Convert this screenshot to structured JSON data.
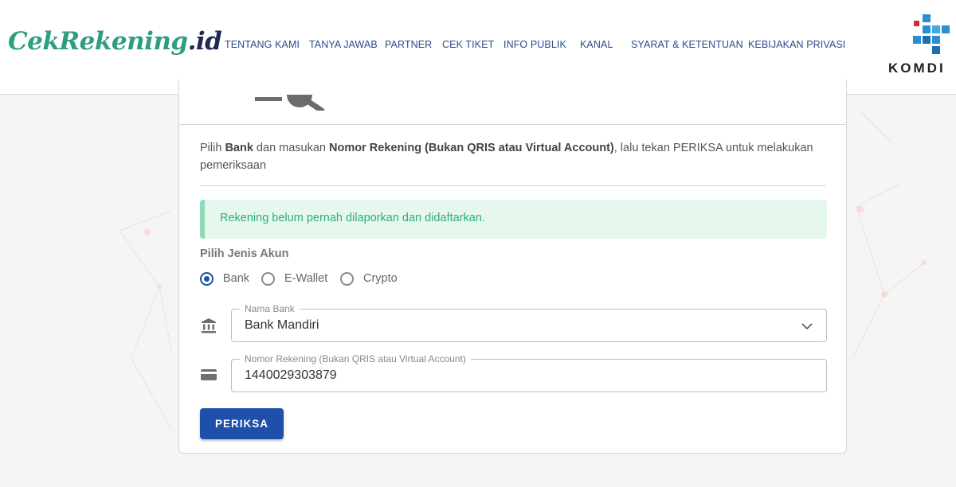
{
  "header": {
    "logo_main": "CekRekening",
    "logo_suffix": ".id",
    "nav": [
      {
        "label": "TENTANG KAMI"
      },
      {
        "label": "TANYA JAWAB"
      },
      {
        "label": "PARTNER"
      },
      {
        "label": "CEK TIKET"
      },
      {
        "label": "INFO PUBLIK"
      },
      {
        "label": "KANAL"
      },
      {
        "label": "SYARAT & KETENTUAN"
      },
      {
        "label": "KEBIJAKAN PRIVASI"
      }
    ],
    "partner_logo_text": "KOMDI"
  },
  "form": {
    "instructions": {
      "pre": "Pilih ",
      "bold1": "Bank",
      "mid": " dan masukan ",
      "bold2": "Nomor Rekening (Bukan QRIS atau Virtual Account)",
      "post": ", lalu tekan PERIKSA untuk melakukan pemeriksaan"
    },
    "alert_message": "Rekening belum pernah dilaporkan dan didaftarkan.",
    "account_type_label": "Pilih Jenis Akun",
    "account_types": [
      {
        "label": "Bank",
        "checked": true
      },
      {
        "label": "E-Wallet",
        "checked": false
      },
      {
        "label": "Crypto",
        "checked": false
      }
    ],
    "bank_field": {
      "label": "Nama Bank",
      "value": "Bank Mandiri"
    },
    "account_field": {
      "label": "Nomor Rekening (Bukan QRIS atau Virtual Account)",
      "value": "1440029303879"
    },
    "submit_label": "PERIKSA"
  },
  "colors": {
    "primary": "#1f4fa8",
    "nav_text": "#2c4a8c",
    "logo_green": "#2f9d80",
    "alert_bg": "#e6f7ee",
    "alert_text": "#2dae77"
  },
  "icons": {
    "bank_field": "bank-icon",
    "account_field": "credit-card-icon",
    "dropdown": "chevron-down-icon",
    "illustration": "search-icon"
  }
}
